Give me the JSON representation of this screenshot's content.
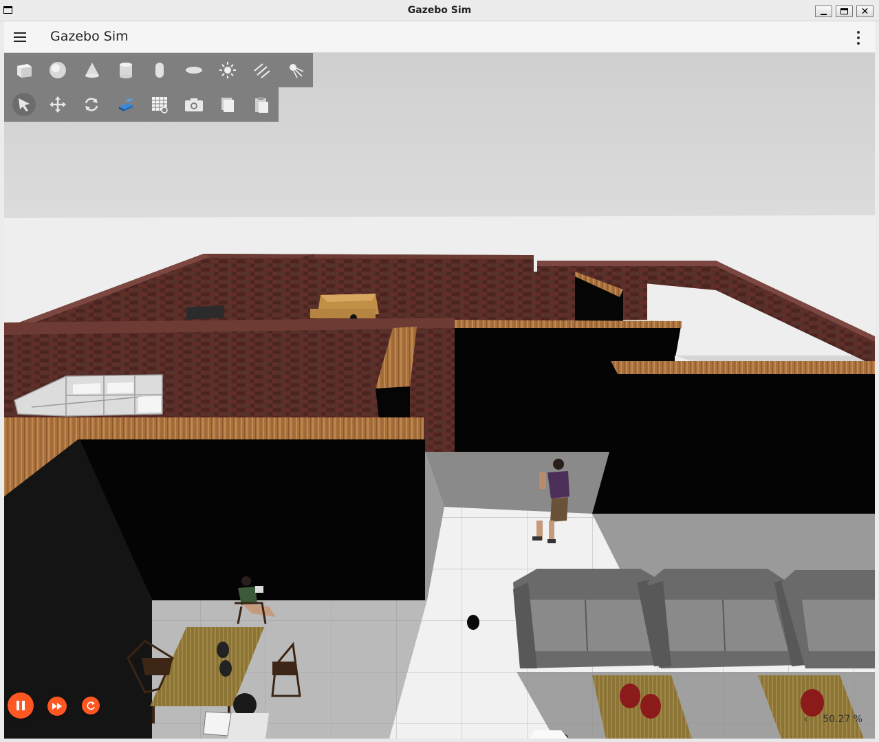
{
  "window": {
    "title": "Gazebo Sim"
  },
  "appbar": {
    "title": "Gazebo Sim"
  },
  "toolbar": {
    "shapes": [
      "box",
      "sphere",
      "cone",
      "cylinder",
      "capsule",
      "ellipsoid",
      "light",
      "directional-light",
      "spot-light"
    ],
    "tools": [
      "select",
      "translate",
      "rotate",
      "transform-control",
      "grid",
      "screenshot",
      "copy",
      "paste"
    ],
    "active_tool": "select"
  },
  "playback": {
    "state": "paused",
    "rtf": "50.27 %"
  }
}
